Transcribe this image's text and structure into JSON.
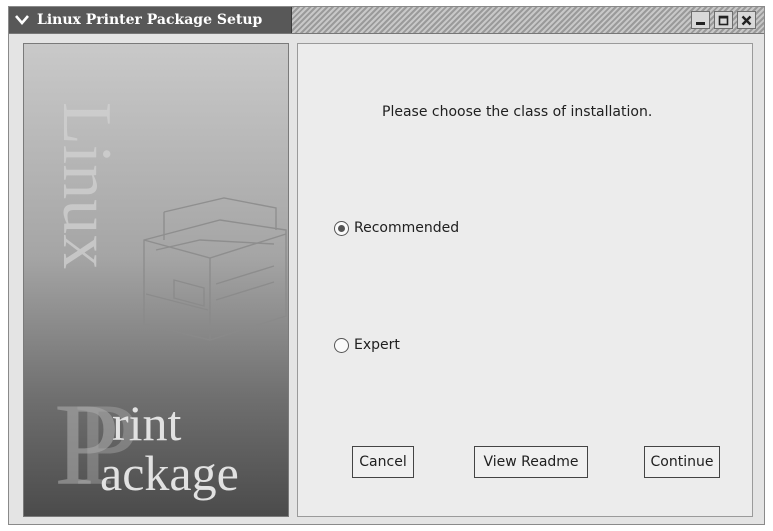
{
  "window": {
    "title": "Linux Printer Package Setup",
    "controls": {
      "menu_icon": "chevron-down-icon",
      "minimize_icon": "minimize-icon",
      "maximize_icon": "maximize-icon",
      "close_icon": "close-icon"
    }
  },
  "side_panel": {
    "vertical_word": "Linux",
    "logo_line1": "rint",
    "logo_line2": "ackage",
    "logo_initial": "P",
    "illustration": "printer-illustration"
  },
  "main": {
    "prompt": "Please choose the class of installation.",
    "options": [
      {
        "label": "Recommended",
        "selected": true
      },
      {
        "label": "Expert",
        "selected": false
      }
    ],
    "buttons": {
      "cancel": "Cancel",
      "view_readme": "View Readme",
      "continue": "Continue"
    }
  },
  "colors": {
    "titlebar_dark": "#585858",
    "panel_bg": "#ececec"
  }
}
